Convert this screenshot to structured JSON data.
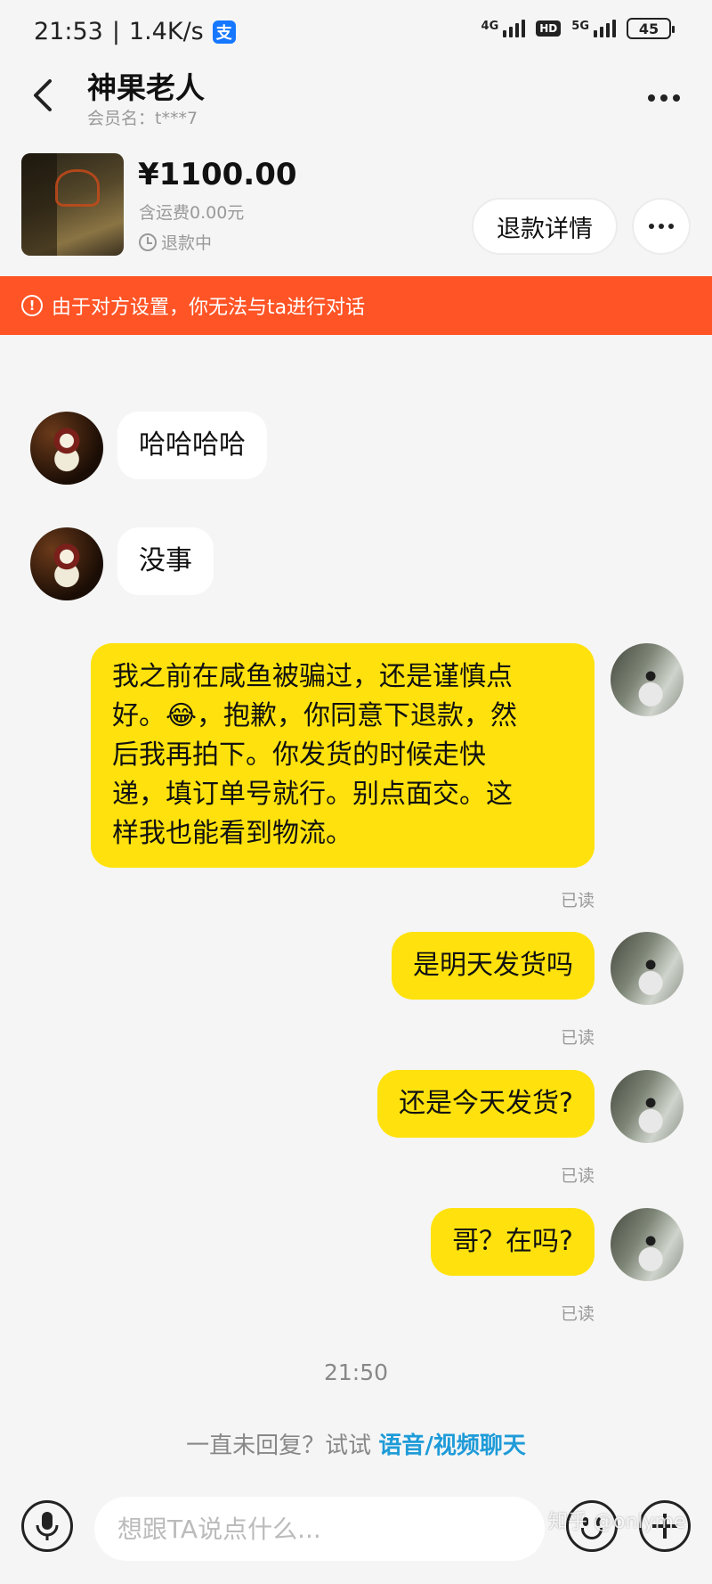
{
  "status_bar": {
    "time": "21:53",
    "separator": "|",
    "speed": "1.4K/s",
    "app_badge": "支",
    "net1": "4G",
    "hd": "HD",
    "net2": "5G",
    "battery": "45"
  },
  "header": {
    "title": "神果老人",
    "member_label": "会员名：t***7"
  },
  "product": {
    "price": "¥1100.00",
    "shipping": "含运费0.00元",
    "status": "退款中",
    "refund_button": "退款详情"
  },
  "banner": {
    "icon": "!",
    "text": "由于对方设置，你无法与ta进行对话"
  },
  "messages": [
    {
      "side": "in",
      "text": "哈哈哈哈"
    },
    {
      "side": "in",
      "text": "没事"
    },
    {
      "side": "out",
      "text_lines": [
        "我之前在咸鱼被骗过，还是谨慎点",
        "好。😂，抱歉，你同意下退款，然",
        "后我再拍下。你发货的时候走快",
        "递，填订单号就行。别点面交。这",
        "样我也能看到物流。"
      ],
      "read": "已读"
    },
    {
      "side": "out",
      "text": "是明天发货吗",
      "read": "已读"
    },
    {
      "side": "out",
      "text": "还是今天发货?",
      "read": "已读"
    },
    {
      "side": "out",
      "text": "哥？在吗?",
      "read": "已读"
    }
  ],
  "top_read": "已读",
  "timestamp": "21:50",
  "hint": {
    "prefix": "一直未回复？试试 ",
    "link": "语音/视频聊天"
  },
  "input": {
    "placeholder": "想跟TA说点什么..."
  },
  "watermark": "知乎 @onlyme",
  "colors": {
    "banner": "#ff5426",
    "outgoing_bubble": "#ffe20d",
    "link": "#1e9bd8"
  }
}
